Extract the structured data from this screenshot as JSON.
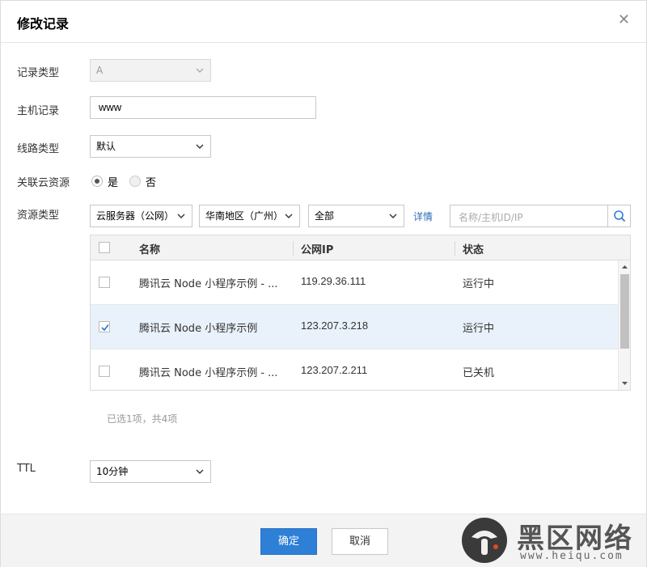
{
  "dialog": {
    "title": "修改记录"
  },
  "form": {
    "record_type": {
      "label": "记录类型",
      "value": "A"
    },
    "host_record": {
      "label": "主机记录",
      "value": "www"
    },
    "line_type": {
      "label": "线路类型",
      "value": "默认"
    },
    "link_resource": {
      "label": "关联云资源",
      "options": [
        "是",
        "否"
      ],
      "selected": "是"
    },
    "resource_type": {
      "label": "资源类型",
      "service_select": "云服务器（公网）",
      "region_select": "华南地区（广州）",
      "filter_select": "全部",
      "detail_link": "详情",
      "search_placeholder": "名称/主机ID/IP"
    },
    "ttl": {
      "label": "TTL",
      "value": "10分钟"
    }
  },
  "table": {
    "headers": {
      "name": "名称",
      "ip": "公网IP",
      "status": "状态"
    },
    "rows": [
      {
        "name": "腾讯云 Node 小程序示例 - ...",
        "ip": "119.29.36.111",
        "status": "运行中",
        "checked": false
      },
      {
        "name": "腾讯云 Node 小程序示例",
        "ip": "123.207.3.218",
        "status": "运行中",
        "checked": true
      },
      {
        "name": "腾讯云 Node 小程序示例 - ...",
        "ip": "123.207.2.211",
        "status": "已关机",
        "checked": false
      }
    ],
    "summary": "已选1项，共4项"
  },
  "footer": {
    "ok_label": "确定",
    "cancel_label": "取消"
  },
  "watermark": {
    "title": "黑区网络",
    "url": "www.heiqu.com"
  },
  "colors": {
    "primary": "#2e7fd6",
    "link": "#2b6bb3",
    "selected_row": "#e9f1fa"
  },
  "icons": {
    "close": "close-icon",
    "dropdown": "chevron-down-icon",
    "search": "search-icon",
    "check": "check-icon"
  }
}
